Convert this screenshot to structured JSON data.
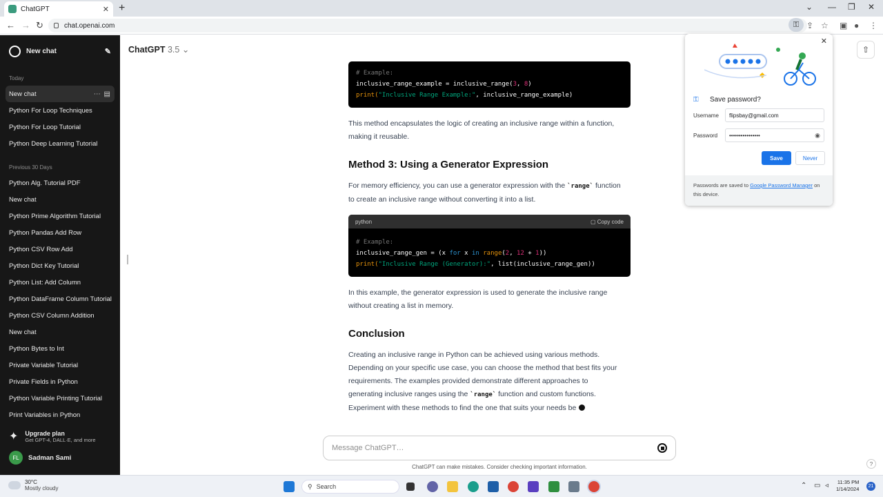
{
  "browser": {
    "tab_title": "ChatGPT",
    "url": "chat.openai.com",
    "new_tab": "+",
    "close_tab": "✕"
  },
  "sidebar": {
    "new_chat": "New chat",
    "today_label": "Today",
    "today_items": [
      "New chat",
      "Python For Loop Techniques",
      "Python For Loop Tutorial",
      "Python Deep Learning Tutorial"
    ],
    "prev30_label": "Previous 30 Days",
    "prev30_items": [
      "Python Alg. Tutorial PDF",
      "New chat",
      "Python Prime Algorithm Tutorial",
      "Python Pandas Add Row",
      "Python CSV Row Add",
      "Python Dict Key Tutorial",
      "Python List: Add Column",
      "Python DataFrame Column Tutorial",
      "Python CSV Column Addition",
      "New chat",
      "Python Bytes to Int",
      "Private Variable Tutorial",
      "Private Fields in Python",
      "Python Variable Printing Tutorial",
      "Print Variables in Python"
    ],
    "upgrade_title": "Upgrade plan",
    "upgrade_sub": "Get GPT-4, DALL·E, and more",
    "user_initials": "FL",
    "user_name": "Sadman Sami"
  },
  "header": {
    "model": "ChatGPT",
    "version": "3.5"
  },
  "content": {
    "code1": {
      "comment": "# Example:",
      "line2a": "inclusive_range_example = inclusive_range(",
      "n1": "3",
      "sep": ", ",
      "n2": "8",
      "close": ")",
      "print": "print(",
      "str": "\"Inclusive Range Example:\"",
      "tail": ", inclusive_range_example)"
    },
    "para1": "This method encapsulates the logic of creating an inclusive range within a function, making it reusable.",
    "h_method3": "Method 3: Using a Generator Expression",
    "para2_a": "For memory efficiency, you can use a generator expression with the ",
    "para2_code": "`range`",
    "para2_b": " function to create an inclusive range without converting it into a list.",
    "code2": {
      "lang": "python",
      "copy": "Copy code",
      "comment": "# Example:",
      "l2a": "inclusive_range_gen = (x ",
      "for": "for",
      "x": " x ",
      "in": "in",
      "sp": " ",
      "range": "range",
      "p": "(",
      "n1": "2",
      "c": ", ",
      "n2": "12",
      "plus": " + ",
      "n3": "1",
      "end": "))",
      "print": "print(",
      "str": "\"Inclusive Range (Generator):\"",
      "tail": ", list(inclusive_range_gen))"
    },
    "para3": "In this example, the generator expression is used to generate the inclusive range without creating a list in memory.",
    "h_conclusion": "Conclusion",
    "para4_a": "Creating an inclusive range in Python can be achieved using various methods. Depending on your specific use case, you can choose the method that best fits your requirements. The examples provided demonstrate different approaches to generating inclusive ranges using the ",
    "para4_code": "`range`",
    "para4_b": " function and custom functions. Experiment with these methods to find the one that suits your needs be"
  },
  "composer": {
    "placeholder": "Message ChatGPT…",
    "disclaimer": "ChatGPT can make mistakes. Consider checking important information.",
    "help": "?"
  },
  "password_popup": {
    "title": "Save password?",
    "username_label": "Username",
    "username_value": "flipsbay@gmail.com",
    "password_label": "Password",
    "password_value": "••••••••••••••••",
    "save": "Save",
    "never": "Never",
    "foot_a": "Passwords are saved to ",
    "foot_link": "Google Password Manager",
    "foot_b": " on this device."
  },
  "taskbar": {
    "temp": "30°C",
    "weather": "Mostly cloudy",
    "search": "Search",
    "time": "11:35 PM",
    "date": "1/14/2024",
    "badge": "21"
  },
  "colors": {
    "sidebar_bg": "#171717",
    "accent_blue": "#1a73e8",
    "code_bg": "#000000"
  }
}
